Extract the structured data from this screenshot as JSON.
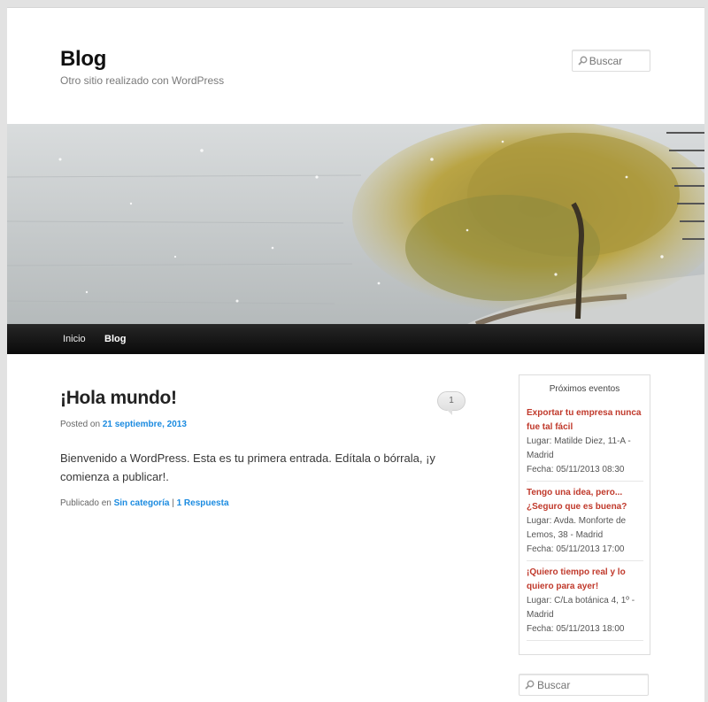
{
  "header": {
    "site_title": "Blog",
    "site_description": "Otro sitio realizado con WordPress",
    "search_placeholder": "Buscar"
  },
  "nav": {
    "items": [
      {
        "label": "Inicio",
        "current": false
      },
      {
        "label": "Blog",
        "current": true
      }
    ]
  },
  "post": {
    "title": "¡Hola mundo!",
    "comment_count": "1",
    "posted_on_prefix": "Posted on",
    "date": "21 septiembre, 2013",
    "body": "Bienvenido a WordPress. Esta es tu primera entrada. Edítala o bórrala, ¡y comienza a publicar!.",
    "footer_prefix": "Publicado en",
    "category": "Sin categoría",
    "separator": "|",
    "responses": "1 Respuesta"
  },
  "sidebar": {
    "events_title": "Próximos eventos",
    "events": [
      {
        "title": "Exportar tu empresa nunca fue tal fácil",
        "place": "Lugar: Matilde Diez, 11-A - Madrid",
        "date": "Fecha: 05/11/2013 08:30"
      },
      {
        "title": "Tengo una idea, pero... ¿Seguro que es buena?",
        "place": "Lugar: Avda. Monforte de Lemos, 38 - Madrid",
        "date": "Fecha: 05/11/2013 17:00"
      },
      {
        "title": "¡Quiero tiempo real y lo quiero para ayer!",
        "place": "Lugar: C/La botánica 4, 1º - Madrid",
        "date": "Fecha: 05/11/2013 18:00"
      }
    ],
    "search_placeholder": "Buscar"
  },
  "colors": {
    "link": "#1b8be0",
    "event_title": "#c0392b",
    "nav_bg": "#111111"
  }
}
